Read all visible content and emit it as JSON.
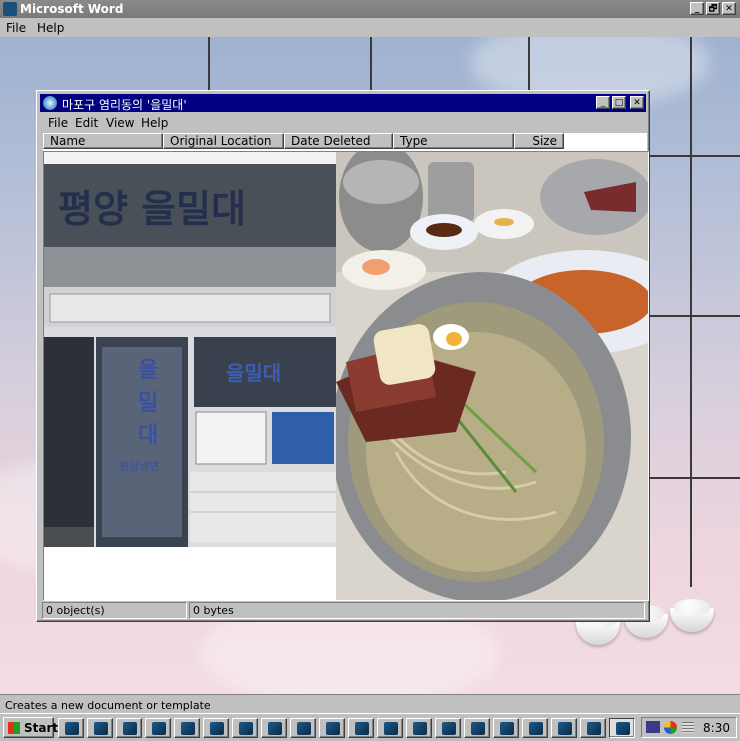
{
  "app": {
    "title": "Microsoft Word",
    "menu": [
      {
        "label": "File",
        "key": "F"
      },
      {
        "label": "Help",
        "key": "H"
      }
    ],
    "controls": {
      "minimize": "_",
      "maximize": "🗗",
      "close": "✕"
    }
  },
  "window": {
    "title": "마포구 염리동의 '을밀대'",
    "menu": [
      "File",
      "Edit",
      "View",
      "Help"
    ],
    "columns": [
      "Name",
      "Original Location",
      "Date Deleted",
      "Type",
      "Size"
    ],
    "status": {
      "objects": "0 object(s)",
      "bytes": "0 bytes"
    },
    "controls": {
      "minimize": "_",
      "maximize": "□",
      "close": "✕"
    }
  },
  "content": {
    "left_photo": {
      "subject": "storefront",
      "sign_text": "을밀대",
      "sub_sign": "평양냉면"
    },
    "right_photo": {
      "subject": "cold-noodles-bowl"
    }
  },
  "bottom_status": "Creates a new document or template",
  "taskbar": {
    "start_label": "Start",
    "task_count": 20,
    "clock": "8:30"
  },
  "colors": {
    "window_title": "#000080",
    "chrome": "#c0c0c0",
    "desktop_top": "#9fb2d0",
    "desktop_bottom": "#f3dce4"
  }
}
